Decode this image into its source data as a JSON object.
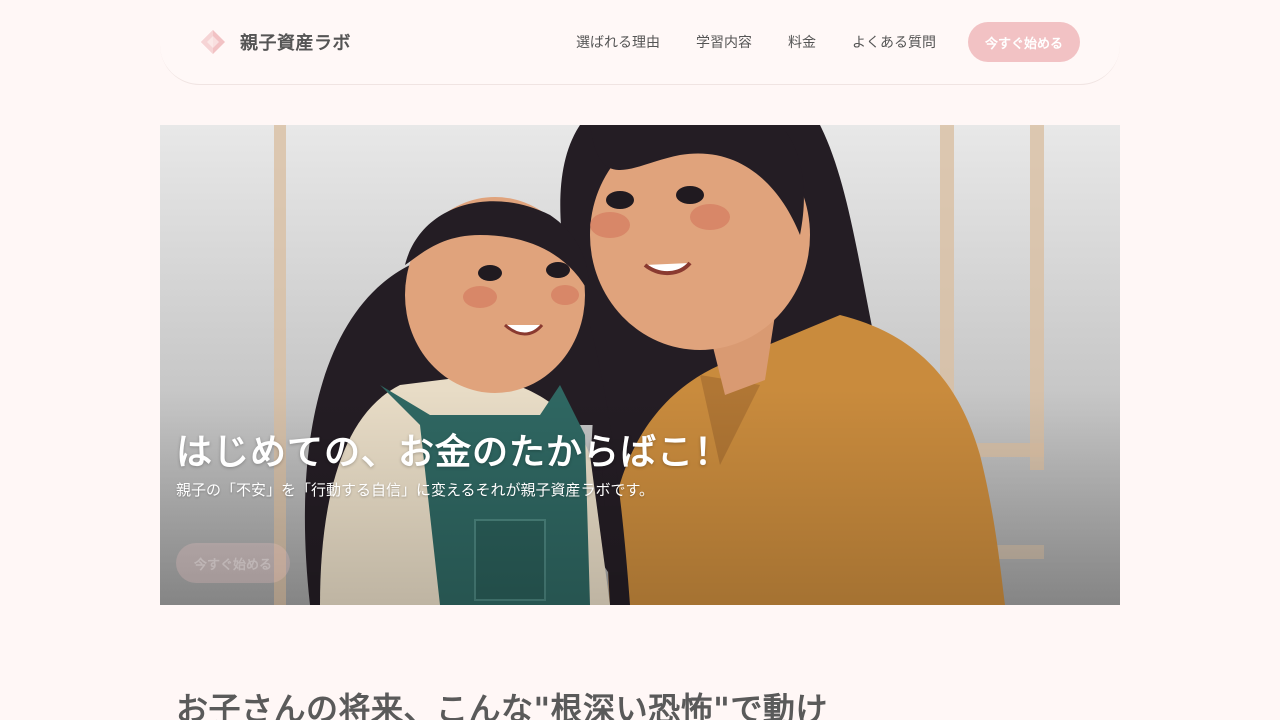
{
  "header": {
    "brand_name": "親子資産ラボ",
    "nav": [
      {
        "label": "選ばれる理由"
      },
      {
        "label": "学習内容"
      },
      {
        "label": "料金"
      },
      {
        "label": "よくある質問"
      }
    ],
    "cta_label": "今すぐ始める"
  },
  "hero": {
    "title": "はじめての、お金のたからばこ！",
    "subtitle": "親子の「不安」を「行動する自信」に変えるそれが親子資産ラボです。",
    "button_label": "今すぐ始める"
  },
  "section": {
    "title": "お子さんの将来、こんな\"根深い恐怖\"で動け"
  },
  "colors": {
    "background": "#fff7f6",
    "accent": "#f2c2c4",
    "text": "#555555"
  },
  "icons": {
    "brand": "diamond-logo-icon"
  }
}
